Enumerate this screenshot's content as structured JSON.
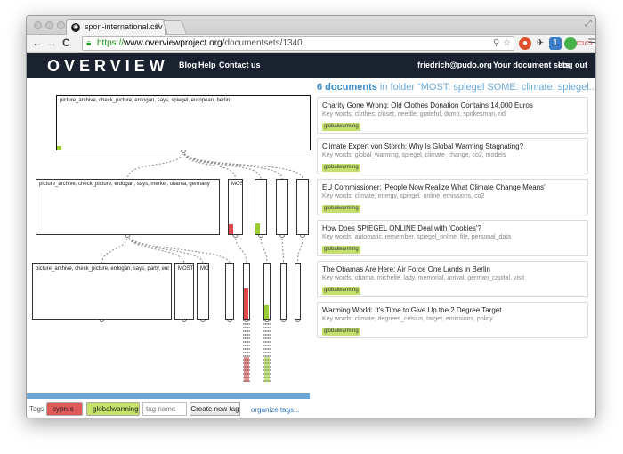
{
  "browser": {
    "tab_title": "spon-international.csv",
    "tab_close": "×",
    "url_scheme": "https://",
    "url_host": "www.overviewproject.org",
    "url_path": "/documentsets/1340",
    "back": "←",
    "forward": "→",
    "reload": "C",
    "badge_count": "1"
  },
  "app_nav": {
    "logo": "OVERVIEW",
    "links": [
      "Blog",
      "Help",
      "Contact us"
    ],
    "user": "friedrich@pudo.org",
    "document_sets": "Your document sets",
    "logout": "Log out"
  },
  "tree": {
    "nodes": [
      {
        "label": "picture_archive, check_picture, erdogan, says, spiegel, european, berlin",
        "fill": 0.06,
        "bar": "#9acd32"
      },
      {
        "label": "picture_archive, check_picture, erdogan, says, merkel, obama, germany",
        "fill": 0
      },
      {
        "label": "MOST",
        "fill": 0.18,
        "bar": "#e04a4a"
      },
      {
        "label": "",
        "fill": 0.2,
        "bar": "#9acd32"
      },
      {
        "label": "",
        "fill": 0
      },
      {
        "label": "",
        "fill": 0
      },
      {
        "label": "picture_archive, check_picture, erdogan, says, party, eur",
        "fill": 0
      },
      {
        "label": "MOST:",
        "fill": 0
      },
      {
        "label": "MO",
        "fill": 0
      },
      {
        "label": "",
        "fill": 0
      },
      {
        "label": "",
        "fill": 0.55,
        "bar": "#e04a4a"
      },
      {
        "label": "",
        "fill": 0.25,
        "bar": "#9acd32"
      },
      {
        "label": "",
        "fill": 0
      },
      {
        "label": "",
        "fill": 0
      }
    ]
  },
  "tags": {
    "label": "Tags",
    "items": [
      {
        "name": "cyprus",
        "color": "#e05a5a"
      },
      {
        "name": "globalwarming",
        "color": "#c6e26a"
      }
    ],
    "input_placeholder": "tag name",
    "create_button": "Create new tag",
    "organize_link": "organize tags..."
  },
  "documents": {
    "count_text": "6 documents",
    "folder_text": " in folder “MOST: spiegel SOME: climate, spiegel...",
    "keywords_label": "Key words:",
    "items": [
      {
        "title": "Charity Gone Wrong: Old Clothes Donation Contains 14,000 Euros",
        "keywords": "clothes, closet, needle, grateful, dump, spokesman, rid",
        "tag": "globalwarming"
      },
      {
        "title": "Climate Expert von Storch: Why Is Global Warming Stagnating?",
        "keywords": "global_warming, spiegel, climate_change, co2, models",
        "tag": "globalwarming"
      },
      {
        "title": "EU Commissioner: 'People Now Realize What Climate Change Means'",
        "keywords": "climate, energy, spiegel_online, emissions, co2",
        "tag": "globalwarming"
      },
      {
        "title": "How Does SPIEGEL ONLINE Deal with 'Cookies'?",
        "keywords": "automatic, remember, spiegel_online, file, personal_data",
        "tag": "globalwarming"
      },
      {
        "title": "The Obamas Are Here: Air Force One Lands in Berlin",
        "keywords": "obama, michelle, lady, memorial, arrival, german_capital, visit",
        "tag": "globalwarming"
      },
      {
        "title": "Warming World: It's Time to Give Up the 2 Degree Target",
        "keywords": "climate, degrees_celsius, target, emissions, policy",
        "tag": "globalwarming"
      }
    ]
  }
}
